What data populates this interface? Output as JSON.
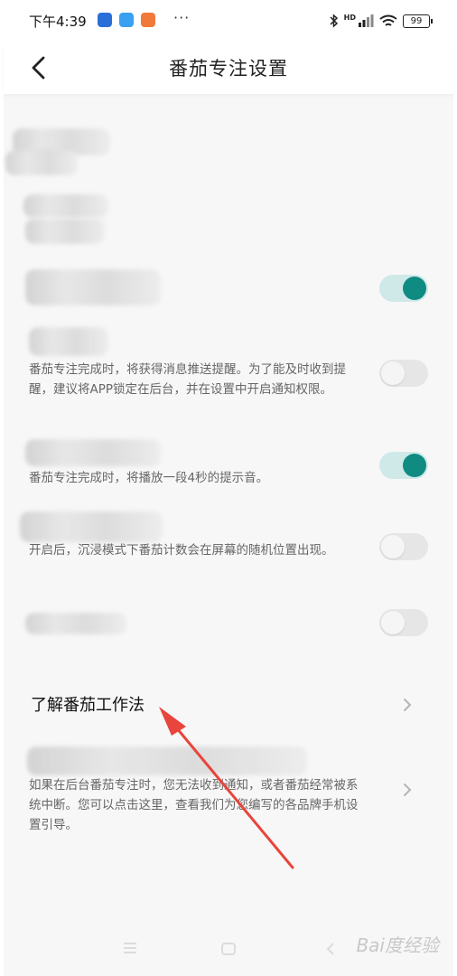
{
  "status_bar": {
    "time": "下午4:39",
    "dots": "···",
    "network": "HD",
    "battery": "99"
  },
  "header": {
    "title": "番茄专注设置"
  },
  "settings": {
    "notify_desc": "番茄专注完成时，将获得消息推送提醒。为了能及时收到提醒，建议将APP锁定在后台，并在设置中开启通知权限。",
    "sound_desc": "番茄专注完成时，将播放一段4秒的提示音。",
    "immersive_desc": "开启后，沉浸模式下番茄计数会在屏幕的随机位置出现。",
    "toggle_states": [
      "on",
      "off",
      "on",
      "off",
      "off"
    ],
    "learn_title": "了解番茄工作法",
    "guide_desc": "如果在后台番茄专注时，您无法收到通知，或者番茄经常被系统中断。您可以点击这里，查看我们为您编写的各品牌手机设置引导。"
  },
  "watermark": "Bai度经验",
  "colors": {
    "accent": "#0f8b82",
    "accent_track": "#cfe9e9",
    "arrow": "#e8453c"
  }
}
